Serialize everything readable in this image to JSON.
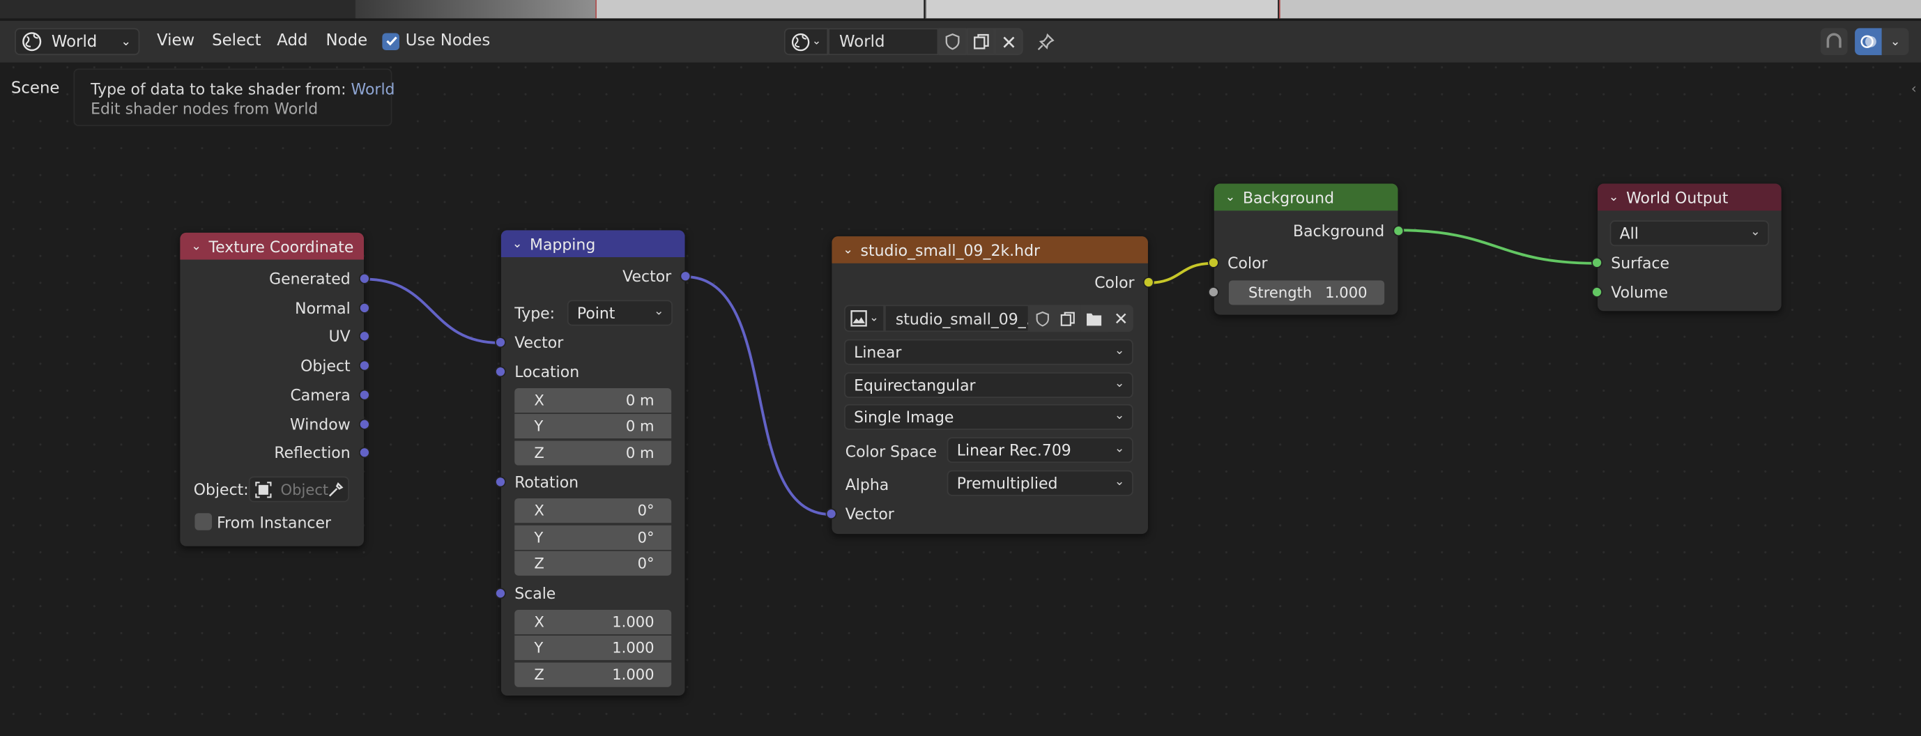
{
  "colors": {
    "texture_coordinate_header": "#8e3446",
    "mapping_header": "#3b3b8d",
    "image_header": "#7a4520",
    "background_header": "#3b6e2f",
    "world_output_header": "#5a2232",
    "vector_socket": "#6363c7",
    "color_socket": "#c7c729",
    "shader_socket": "#63c763"
  },
  "header": {
    "editor_type_icon": "globe-icon",
    "data_source": "World",
    "menus": [
      "View",
      "Select",
      "Add",
      "Node"
    ],
    "use_nodes_label": "Use Nodes",
    "use_nodes_checked": true,
    "world_name": "World"
  },
  "breadcrumb": "Scene",
  "tooltip": {
    "line1_prefix": "Type of data to take shader from: ",
    "line1_value": "World",
    "line2": "Edit shader nodes from World"
  },
  "nodes": {
    "texcoord": {
      "title": "Texture Coordinate",
      "outputs": [
        "Generated",
        "Normal",
        "UV",
        "Object",
        "Camera",
        "Window",
        "Reflection"
      ],
      "object_label": "Object:",
      "object_placeholder": "Object",
      "from_instancer_label": "From Instancer"
    },
    "mapping": {
      "title": "Mapping",
      "output": "Vector",
      "type_label": "Type:",
      "type_value": "Point",
      "vector_input": "Vector",
      "location_label": "Location",
      "location": [
        {
          "axis": "X",
          "value": "0 m"
        },
        {
          "axis": "Y",
          "value": "0 m"
        },
        {
          "axis": "Z",
          "value": "0 m"
        }
      ],
      "rotation_label": "Rotation",
      "rotation": [
        {
          "axis": "X",
          "value": "0°"
        },
        {
          "axis": "Y",
          "value": "0°"
        },
        {
          "axis": "Z",
          "value": "0°"
        }
      ],
      "scale_label": "Scale",
      "scale": [
        {
          "axis": "X",
          "value": "1.000"
        },
        {
          "axis": "Y",
          "value": "1.000"
        },
        {
          "axis": "Z",
          "value": "1.000"
        }
      ]
    },
    "image": {
      "title": "studio_small_09_2k.hdr",
      "output": "Color",
      "image_name": "studio_small_09_...",
      "interpolation": "Linear",
      "projection": "Equirectangular",
      "source": "Single Image",
      "color_space_label": "Color Space",
      "color_space_value": "Linear Rec.709",
      "alpha_label": "Alpha",
      "alpha_value": "Premultiplied",
      "vector_input": "Vector"
    },
    "background": {
      "title": "Background",
      "output": "Background",
      "color_input": "Color",
      "strength_label": "Strength",
      "strength_value": "1.000"
    },
    "world_output": {
      "title": "World Output",
      "target": "All",
      "surface_input": "Surface",
      "volume_input": "Volume"
    }
  }
}
